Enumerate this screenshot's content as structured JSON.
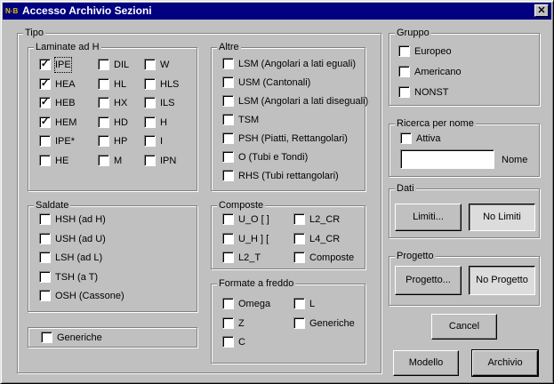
{
  "window": {
    "title": "Accesso Archivio Sezioni",
    "close_glyph": "✕",
    "icon_text": "N·B"
  },
  "tipo": {
    "label": "Tipo",
    "laminate": {
      "label": "Laminate ad H",
      "items": [
        {
          "label": "IPE",
          "checked": true
        },
        {
          "label": "HEA",
          "checked": true
        },
        {
          "label": "HEB",
          "checked": true
        },
        {
          "label": "HEM",
          "checked": true
        },
        {
          "label": "IPE*",
          "checked": false
        },
        {
          "label": "HE",
          "checked": false
        },
        {
          "label": "DIL",
          "checked": false
        },
        {
          "label": "HL",
          "checked": false
        },
        {
          "label": "HX",
          "checked": false
        },
        {
          "label": "HD",
          "checked": false
        },
        {
          "label": "HP",
          "checked": false
        },
        {
          "label": "M",
          "checked": false
        },
        {
          "label": "W",
          "checked": false
        },
        {
          "label": "HLS",
          "checked": false
        },
        {
          "label": "ILS",
          "checked": false
        },
        {
          "label": "H",
          "checked": false
        },
        {
          "label": "I",
          "checked": false
        },
        {
          "label": "IPN",
          "checked": false
        }
      ]
    },
    "altre": {
      "label": "Altre",
      "items": [
        {
          "label": "LSM (Angolari a lati eguali)",
          "checked": false
        },
        {
          "label": "USM (Cantonali)",
          "checked": false
        },
        {
          "label": "LSM (Angolari a lati diseguali)",
          "checked": false
        },
        {
          "label": "TSM",
          "checked": false
        },
        {
          "label": "PSH (Piatti, Rettangolari)",
          "checked": false
        },
        {
          "label": "O (Tubi e Tondi)",
          "checked": false
        },
        {
          "label": "RHS (Tubi rettangolari)",
          "checked": false
        }
      ]
    },
    "saldate": {
      "label": "Saldate",
      "items": [
        {
          "label": "HSH (ad H)",
          "checked": false
        },
        {
          "label": "USH (ad U)",
          "checked": false
        },
        {
          "label": "LSH (ad L)",
          "checked": false
        },
        {
          "label": "TSH (a T)",
          "checked": false
        },
        {
          "label": "OSH (Cassone)",
          "checked": false
        }
      ]
    },
    "composte": {
      "label": "Composte",
      "items": [
        {
          "label": "U_O [ ]",
          "checked": false
        },
        {
          "label": "U_H ] [",
          "checked": false
        },
        {
          "label": "L2_T",
          "checked": false
        },
        {
          "label": "L2_CR",
          "checked": false
        },
        {
          "label": "L4_CR",
          "checked": false
        },
        {
          "label": "Composte",
          "checked": false
        }
      ]
    },
    "formate": {
      "label": "Formate a freddo",
      "items": [
        {
          "label": "Omega",
          "checked": false
        },
        {
          "label": "Z",
          "checked": false
        },
        {
          "label": "C",
          "checked": false
        },
        {
          "label": "L",
          "checked": false
        },
        {
          "label": "Generiche",
          "checked": false
        }
      ]
    },
    "generiche": {
      "label": "Generiche",
      "checked": false
    }
  },
  "gruppo": {
    "label": "Gruppo",
    "items": [
      {
        "label": "Europeo",
        "checked": false
      },
      {
        "label": "Americano",
        "checked": false
      },
      {
        "label": "NONST",
        "checked": false
      }
    ]
  },
  "ricerca": {
    "label": "Ricerca per nome",
    "attiva": {
      "label": "Attiva",
      "checked": false
    },
    "input_value": "",
    "nome_label": "Nome"
  },
  "dati": {
    "label": "Dati",
    "limiti": "Limiti...",
    "no_limiti": "No Limiti"
  },
  "progetto": {
    "label": "Progetto",
    "progetto_btn": "Progetto...",
    "no_progetto": "No Progetto"
  },
  "buttons": {
    "cancel": "Cancel",
    "modello": "Modello",
    "archivio": "Archivio"
  }
}
